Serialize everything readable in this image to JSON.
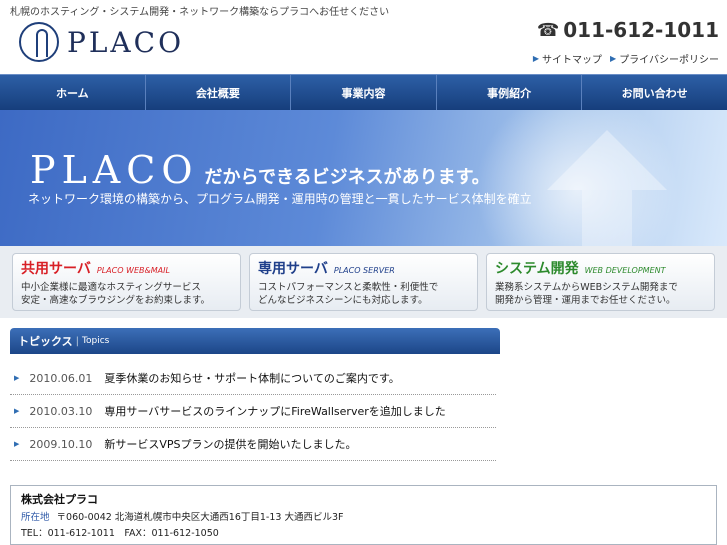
{
  "header": {
    "tagline": "札幌のホスティング・システム開発・ネットワーク構築ならプラコへお任せください",
    "logo_text": "PLACO",
    "phone": "011-612-1011",
    "links": [
      {
        "label": "サイトマップ"
      },
      {
        "label": "プライバシーポリシー"
      }
    ]
  },
  "nav": {
    "items": [
      {
        "label": "ホーム"
      },
      {
        "label": "会社概要"
      },
      {
        "label": "事業内容"
      },
      {
        "label": "事例紹介"
      },
      {
        "label": "お問い合わせ"
      }
    ]
  },
  "hero": {
    "brand": "PLACO",
    "catch": "だからできるビジネスがあります。",
    "sub": "ネットワーク環境の構築から、プログラム開発・運用時の管理と一貫したサービス体制を確立"
  },
  "services": [
    {
      "title": "共用サーバ",
      "en": "PLACO WEB&MAIL",
      "desc1": "中小企業様に最適なホスティングサービス",
      "desc2": "安定・高速なブラウジングをお約束します。",
      "color": "#d81f26"
    },
    {
      "title": "専用サーバ",
      "en": "PLACO SERVER",
      "desc1": "コストパフォーマンスと柔軟性・利便性で",
      "desc2": "どんなビジネスシーンにも対応します。",
      "color": "#1f3f8a"
    },
    {
      "title": "システム開発",
      "en": "WEB DEVELOPMENT",
      "desc1": "業務系システムからWEBシステム開発まで",
      "desc2": "開発から管理・運用までお任せください。",
      "color": "#2d8a2d"
    }
  ],
  "topics": {
    "heading_jp": "トピックス",
    "heading_en": "Topics",
    "items": [
      {
        "date": "2010.06.01",
        "title": "夏季休業のお知らせ・サポート体制についてのご案内です。"
      },
      {
        "date": "2010.03.10",
        "title": "専用サーバサービスのラインナップにFireWallserverを追加しました"
      },
      {
        "date": "2009.10.10",
        "title": "新サービスVPSプランの提供を開始いたしました。"
      }
    ]
  },
  "company": {
    "name": "株式会社プラコ",
    "address_label": "所在地",
    "address": "〒060-0042 北海道札幌市中央区大通西16丁目1-13 大通西ビル3F",
    "contact": "TEL：011-612-1011　FAX：011-612-1050"
  }
}
